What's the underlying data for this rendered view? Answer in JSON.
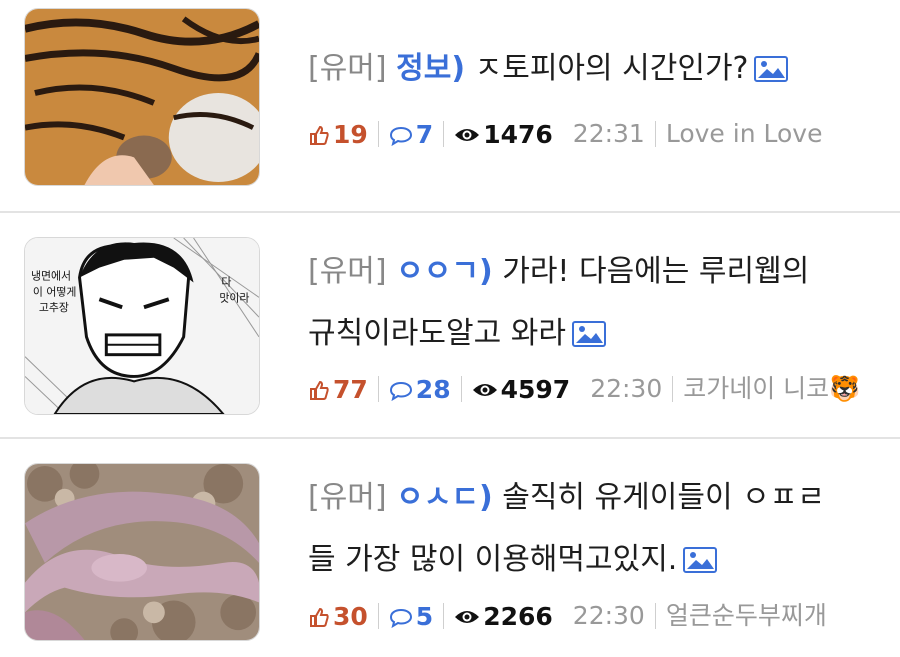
{
  "posts": [
    {
      "tag": "[유머]",
      "category": "정보)",
      "title_lines": [
        "ㅈ토피아의 시간인가?"
      ],
      "likes": "19",
      "comments": "7",
      "views": "1476",
      "time": "22:31",
      "author": "Love in Love",
      "thumbnail": "tiger-photo"
    },
    {
      "tag": "[유머]",
      "category": "ㅇㅇㄱ)",
      "title_lines": [
        "가라! 다음에는 루리웹의",
        "규칙이라도알고 와라"
      ],
      "likes": "77",
      "comments": "28",
      "views": "4597",
      "time": "22:30",
      "author": "코가네이 니코",
      "author_emoji": "🐯",
      "thumbnail": "manga-panel"
    },
    {
      "tag": "[유머]",
      "category": "ㅇㅅㄷ)",
      "title_lines": [
        "솔직히 유게이들이 ㅇㅍㄹ",
        "들 가장 많이 이용해먹고있지."
      ],
      "likes": "30",
      "comments": "5",
      "views": "2266",
      "time": "22:30",
      "author": "얼큰순두부찌개",
      "thumbnail": "caecilian-photo"
    }
  ],
  "colors": {
    "category": "#3a6fd8",
    "likes": "#c5512d",
    "tag": "#888888",
    "meta_muted": "#999999",
    "separator": "#e3e3e3"
  },
  "icons": {
    "likes": "thumbs-up-icon",
    "comments": "speech-bubble-icon",
    "views": "eye-icon",
    "image": "image-icon"
  }
}
